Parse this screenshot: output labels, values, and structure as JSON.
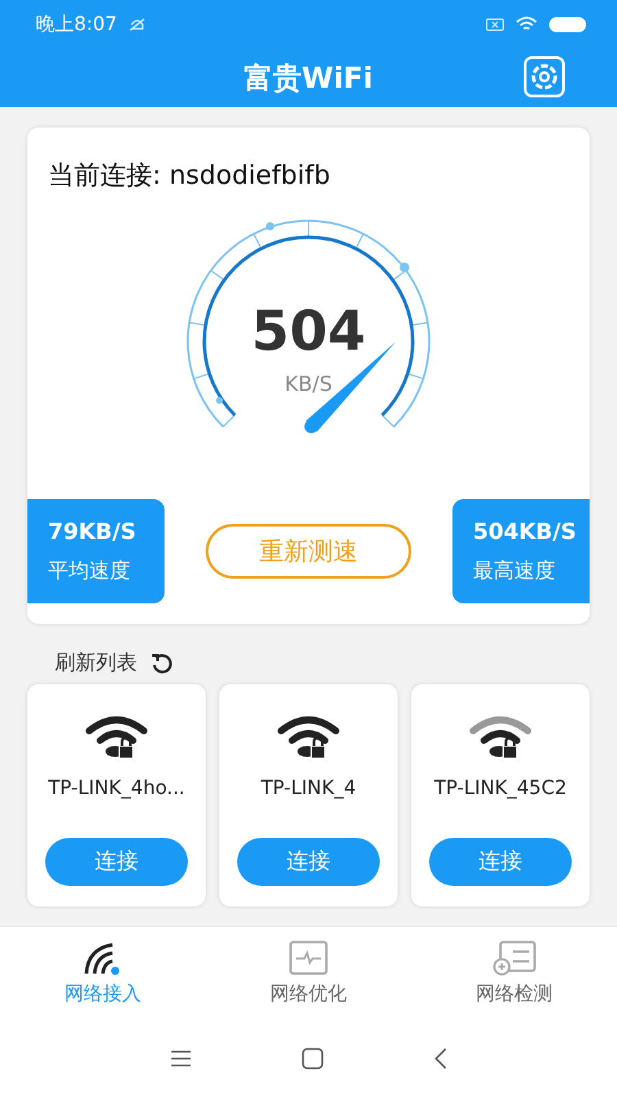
{
  "status_bar": {
    "time": "晚上8:07"
  },
  "header": {
    "title": "富贵WiFi"
  },
  "speed_card": {
    "connection_label": "当前连接: nsdodiefbifb",
    "speed": "504",
    "unit": "KB/S",
    "average": {
      "value": "79KB/S",
      "label": "平均速度"
    },
    "retest_button": "重新测速",
    "max": {
      "value": "504KB/S",
      "label": "最高速度"
    }
  },
  "refresh": {
    "label": "刷新列表"
  },
  "networks": [
    {
      "name": "TP-LINK_4ho...",
      "full_signal": true,
      "button": "连接"
    },
    {
      "name": "TP-LINK_4",
      "full_signal": true,
      "button": "连接"
    },
    {
      "name": "TP-LINK_45C2",
      "full_signal": false,
      "button": "连接"
    }
  ],
  "tabs": [
    {
      "kind": "access",
      "label": "网络接入",
      "selected": true
    },
    {
      "kind": "optimize",
      "label": "网络优化",
      "selected": false
    },
    {
      "kind": "detect",
      "label": "网络检测",
      "selected": false
    }
  ]
}
